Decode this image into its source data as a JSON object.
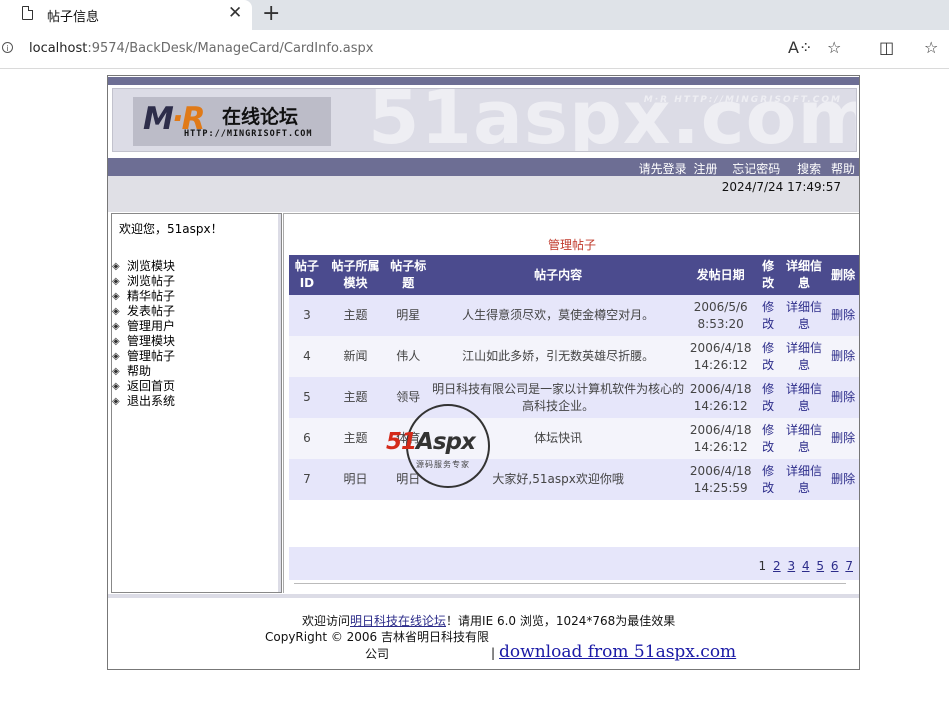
{
  "browser": {
    "tab_title": "帖子信息",
    "url_host": "localhost",
    "url_rest": ":9574/BackDesk/ManageCard/CardInfo.aspx"
  },
  "banner": {
    "watermark": "51aspx.com",
    "watermark_small": "M·R HTTP://MINGRISOFT.COM",
    "logo_mr": "M",
    "logo_r": "·R",
    "logo_cn": "在线论坛",
    "logo_url": "HTTP://MINGRISOFT.COM"
  },
  "nav": {
    "login": "请先登录",
    "register": "注册",
    "forgot": "忘记密码",
    "search": "搜索",
    "help": "帮助"
  },
  "datetime": "2024/7/24 17:49:57",
  "sidebar": {
    "welcome": "欢迎您，51aspx！",
    "items": [
      "浏览模块",
      "浏览帖子",
      "精华帖子",
      "发表帖子",
      "管理用户",
      "管理模块",
      "管理帖子",
      "帮助",
      "返回首页",
      "退出系统"
    ]
  },
  "main": {
    "title": "管理帖子",
    "headers": {
      "id": "帖子ID",
      "module": "帖子所属模块",
      "title": "帖子标题",
      "content": "帖子内容",
      "date": "发帖日期",
      "edit": "修改",
      "detail": "详细信息",
      "delete": "删除"
    },
    "rows": [
      {
        "id": "3",
        "module": "主题",
        "title": "明星",
        "content": "人生得意须尽欢，莫使金樽空对月。",
        "date": "2006/5/6 8:53:20",
        "edit": "修改",
        "detail": "详细信息",
        "delete": "删除"
      },
      {
        "id": "4",
        "module": "新闻",
        "title": "伟人",
        "content": "江山如此多娇，引无数英雄尽折腰。",
        "date": "2006/4/18 14:26:12",
        "edit": "修改",
        "detail": "详细信息",
        "delete": "删除"
      },
      {
        "id": "5",
        "module": "主题",
        "title": "领导",
        "content": "明日科技有限公司是一家以计算机软件为核心的高科技企业。",
        "date": "2006/4/18 14:26:12",
        "edit": "修改",
        "detail": "详细信息",
        "delete": "删除"
      },
      {
        "id": "6",
        "module": "主题",
        "title": "体育",
        "content": "体坛快讯",
        "date": "2006/4/18 14:26:12",
        "edit": "修改",
        "detail": "详细信息",
        "delete": "删除"
      },
      {
        "id": "7",
        "module": "明日",
        "title": "明日",
        "content": "大家好,51aspx欢迎你哦",
        "date": "2006/4/18 14:25:59",
        "edit": "修改",
        "detail": "详细信息",
        "delete": "删除"
      }
    ],
    "pager": {
      "current": "1",
      "pages": [
        "2",
        "3",
        "4",
        "5",
        "6",
        "7"
      ]
    }
  },
  "footer": {
    "visit_prefix": "欢迎访问",
    "forum_link": "明日科技在线论坛",
    "visit_suffix": "！请用IE 6.0 浏览，1024*768为最佳效果",
    "copyright": "CopyRight © 2006 吉林省明日科技有限公司",
    "separator": "|",
    "download_link": "download from 51aspx.com"
  },
  "stamp": {
    "brand_51": "51",
    "brand_aspx": "Aspx",
    "sub": "源码服务专家"
  }
}
